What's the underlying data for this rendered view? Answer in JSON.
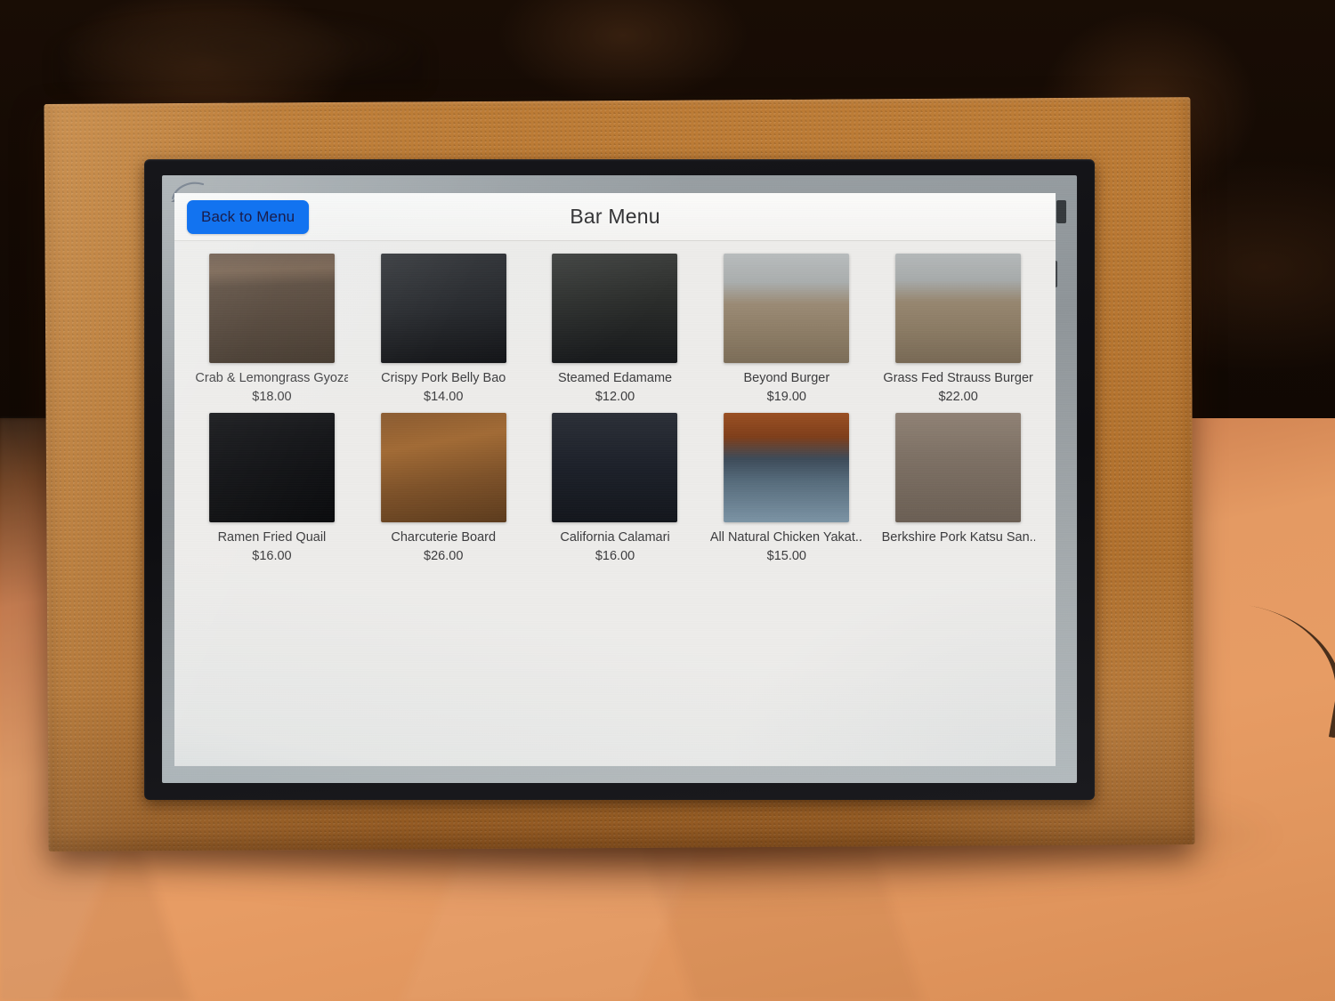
{
  "app": {
    "window_title": "Bar Menu",
    "navbar": {
      "back_label": "Back to Menu",
      "title": "Bar Menu",
      "accent_color": "#1273f0",
      "back_text_color": "#1a1c4a",
      "title_color": "#2c2c2e"
    },
    "colors": {
      "app_background": "#edecea",
      "navbar_background": "#f7f6f4",
      "text": "#3a3a3c",
      "panel_grey": "#9ba2a6",
      "bezel_black": "#141417",
      "stand_fabric": "#b5742f",
      "table_surface": "#e49a63"
    },
    "menu": {
      "columns": 5,
      "items": [
        {
          "name": "Crab & Lemongrass Gyoza",
          "price": "$18.00",
          "photo": "gyoza-on-white-oval-plate-dark-wood",
          "photo_css": "linear-gradient(178deg, #5c4636 0%, #6a513c 16%, #4a3829 30%, #3a2d21 100%), radial-gradient(ellipse 62% 36% at 50% 56%, #cfd6d6 0%, #b9c2c3 46%, #8d9899 70%, rgba(0,0,0,0) 72%), radial-gradient(ellipse 13% 14% at 33% 62%, #c5a168 0%, rgba(0,0,0,0) 70%), radial-gradient(ellipse 13% 14% at 52% 58%, #b8924f 0%, rgba(0,0,0,0) 70%), radial-gradient(ellipse 13% 14% at 70% 52%, #caa264 0%, rgba(0,0,0,0) 70%), radial-gradient(ellipse 11% 10% at 50% 44%, #7fc24a 0%, rgba(0,0,0,0) 72%)"
        },
        {
          "name": "Crispy Pork Belly Bao",
          "price": "$14.00",
          "photo": "pork-belly-bao-buns-on-black-slate",
          "photo_css": "linear-gradient(180deg, #24262a 0%, #1a1c20 52%, #0d0e11 100%), radial-gradient(ellipse 26% 26% at 34% 54%, #f3f2ee 0%, #dcdad4 58%, rgba(0,0,0,0) 74%), radial-gradient(ellipse 26% 26% at 68% 46%, #f3f2ee 0%, #dad8d2 58%, rgba(0,0,0,0) 74%), radial-gradient(ellipse 11% 10% at 42% 60%, #a6572a 0%, rgba(0,0,0,0) 74%), radial-gradient(ellipse 11% 10% at 76% 54%, #9e5227 0%, rgba(0,0,0,0) 74%), radial-gradient(ellipse 7% 6% at 28% 62%, #e0883c 0%, rgba(0,0,0,0) 76%)"
        },
        {
          "name": "Steamed Edamame",
          "price": "$12.00",
          "photo": "edamame-in-dark-bowl-with-lid",
          "photo_css": "linear-gradient(180deg, #3a3c3a 0%, #2a2c2a 40%, #16181a 100%), radial-gradient(ellipse 44% 40% at 50% 58%, #1d3a1e 0%, #14240f 70%, rgba(0,0,0,0) 76%), radial-gradient(ellipse 10% 7% at 40% 56%, #7fae3a 0%, rgba(0,0,0,0) 74%), radial-gradient(ellipse 10% 7% at 58% 62%, #8cb941 0%, rgba(0,0,0,0) 74%), radial-gradient(ellipse 10% 7% at 50% 48%, #79a735 0%, rgba(0,0,0,0) 74%), radial-gradient(ellipse 22% 13% at 62% 24%, #d6d8d3 0%, rgba(0,0,0,0) 74%)"
        },
        {
          "name": "Beyond Burger",
          "price": "$19.00",
          "photo": "burger-with-fries-in-blue-bowl-on-wood",
          "photo_css": "linear-gradient(180deg, #b8bcbd 0%, #a9adad 26%, #9a8a74 46%, #8d7d66 70%, #7b6c57 100%), radial-gradient(ellipse 26% 30% at 63% 27%, #e0b15c 0%, #d2a04c 54%, rgba(0,0,0,0) 72%), radial-gradient(ellipse 20% 24% at 62% 42%, #9fc0d8 0%, #8aafc9 60%, rgba(0,0,0,0) 74%), radial-gradient(ellipse 24% 22% at 30% 50%, #e2b266 0%, #d09f50 62%, rgba(0,0,0,0) 76%), radial-gradient(ellipse 22% 9% at 30% 64%, #6f4228 0%, rgba(0,0,0,0) 76%), radial-gradient(ellipse 20% 6% at 30% 72%, #64a348 0%, rgba(0,0,0,0) 76%), radial-gradient(ellipse 9% 9% at 88% 54%, #f0ece4 0%, rgba(0,0,0,0) 72%), radial-gradient(ellipse 6% 6% at 88% 52%, #a9251c 0%, rgba(0,0,0,0) 74%)"
        },
        {
          "name": "Grass Fed Strauss Burger",
          "price": "$22.00",
          "photo": "burger-with-fries-in-blue-bowl-on-wood",
          "photo_css": "linear-gradient(180deg, #b4b8b9 0%, #a6aaaa 24%, #96866f 44%, #8a7a63 70%, #776854 100%), radial-gradient(ellipse 24% 28% at 33% 24%, #dfb05b 0%, #d09e4b 54%, rgba(0,0,0,0) 72%), radial-gradient(ellipse 19% 23% at 32% 40%, #9cbdd6 0%, #87acc6 60%, rgba(0,0,0,0) 74%), radial-gradient(ellipse 25% 23% at 68% 50%, #e3b368 0%, #d1a052 62%, rgba(0,0,0,0) 76%), radial-gradient(ellipse 22% 9% at 68% 64%, #6d4026 0%, rgba(0,0,0,0) 76%), radial-gradient(ellipse 20% 6% at 68% 72%, #63a247 0%, rgba(0,0,0,0) 76%), radial-gradient(ellipse 11% 9% at 18% 62%, #17201c 0%, rgba(0,0,0,0) 74%)"
        },
        {
          "name": "Ramen Fried Quail",
          "price": "$16.00",
          "photo": "fried-quail-with-microgreens-on-black-plate",
          "photo_css": "linear-gradient(180deg, #141518 0%, #0c0d10 55%, #08090b 100%), radial-gradient(ellipse 40% 34% at 50% 62%, #3e3a26 0%, #262317 64%, rgba(0,0,0,0) 76%), radial-gradient(ellipse 15% 11% at 40% 64%, #6b6332 0%, rgba(0,0,0,0) 74%), radial-gradient(ellipse 15% 11% at 62% 60%, #6f6734 0%, rgba(0,0,0,0) 74%), radial-gradient(ellipse 30% 17% at 50% 33%, #9cc26a 0%, rgba(0,0,0,0) 72%), radial-gradient(ellipse 18% 9% at 44% 24%, #cfe0b4 0%, rgba(0,0,0,0) 74%)"
        },
        {
          "name": "Charcuterie Board",
          "price": "$26.00",
          "photo": "charcuterie-board-with-meats-cheese-crackers",
          "photo_css": "linear-gradient(170deg, #8a5a2f 0%, #a16a34 30%, #7d5128 62%, #5b3a1c 100%), radial-gradient(ellipse 12% 11% at 30% 34%, #b03f3a 0%, rgba(0,0,0,0) 72%), radial-gradient(ellipse 12% 11% at 74% 62%, #a83a35 0%, rgba(0,0,0,0) 72%), radial-gradient(ellipse 10% 10% at 44% 58%, #eae3cb 0%, rgba(0,0,0,0) 74%), radial-gradient(ellipse 10% 10% at 58% 44%, #efe8d0 0%, rgba(0,0,0,0) 74%), radial-gradient(ellipse 9% 9% at 68% 28%, #e8dfc0 0%, rgba(0,0,0,0) 74%), radial-gradient(ellipse 8% 8% at 34% 66%, #d9cfa8 0%, rgba(0,0,0,0) 74%), radial-gradient(ellipse 7% 7% at 52% 24%, #9aa85a 0%, rgba(0,0,0,0) 74%)"
        },
        {
          "name": "California Calamari",
          "price": "$16.00",
          "photo": "fried-calamari-with-lemon-in-dark-skillet",
          "photo_css": "linear-gradient(180deg, #2a2e36 0%, #1c2029 48%, #12151b 100%), radial-gradient(ellipse 44% 42% at 48% 54%, #3a3028 0%, #2a231c 70%, rgba(0,0,0,0) 76%), radial-gradient(ellipse 30% 26% at 44% 56%, #d9a24c 0%, #c28f3e 62%, rgba(0,0,0,0) 76%), radial-gradient(ellipse 13% 13% at 74% 66%, #d2d84e 0%, #b9c23c 62%, rgba(0,0,0,0) 74%), radial-gradient(ellipse 12% 9% at 52% 26%, #7fbb4c 0%, rgba(0,0,0,0) 74%), radial-gradient(ellipse 5% 5% at 44% 34%, #9d78c4 0%, rgba(0,0,0,0) 74%)"
        },
        {
          "name": "All Natural Chicken Yakat...",
          "price": "$15.00",
          "photo": "chicken-yakitori-skewers-on-blue-plate",
          "photo_css": "linear-gradient(180deg, #9a4f22 0%, #7e3d19 22%, #3c4a58 42%, #556a7a 62%, #7b93a4 100%), radial-gradient(ellipse 58% 26% at 50% 58%, #b8ccd8 0%, #9ab3c3 62%, rgba(0,0,0,0) 74%), radial-gradient(ellipse 9% 9% at 34% 52%, #7a4a22 0%, rgba(0,0,0,0) 72%), radial-gradient(ellipse 9% 9% at 50% 50%, #85521f 0%, rgba(0,0,0,0) 72%), radial-gradient(ellipse 9% 9% at 66% 54%, #7c4d22 0%, rgba(0,0,0,0) 72%), radial-gradient(ellipse 12% 10% at 78% 44%, #4f8a3a 0%, rgba(0,0,0,0) 72%), linear-gradient(92deg, rgba(0,0,0,0) 18%, rgba(190,170,140,0.5) 20%, rgba(0,0,0,0) 22%)"
        },
        {
          "name": "Berkshire Pork Katsu San...",
          "price": "",
          "photo": "katsu-sandwich-with-fries-and-ketchup",
          "photo_css": "linear-gradient(180deg, #8f8174 0%, #7d7064 40%, #6a5e53 100%), radial-gradient(ellipse 28% 30% at 70% 22%, #e0b15c 0%, #d09e4c 56%, rgba(0,0,0,0) 72%), radial-gradient(ellipse 22% 26% at 70% 40%, #9dbed6 0%, #88adc7 60%, rgba(0,0,0,0) 74%), radial-gradient(ellipse 16% 22% at 34% 48%, #f2ece0 0%, #e2dacb 60%, rgba(0,0,0,0) 74%), radial-gradient(ellipse 16% 22% at 50% 52%, #f0eade 0%, #ded6c6 60%, rgba(0,0,0,0) 74%), radial-gradient(ellipse 10% 10% at 86% 70%, #eeeae2 0%, rgba(0,0,0,0) 72%), radial-gradient(ellipse 7% 7% at 86% 70%, #9e2218 0%, rgba(0,0,0,0) 74%)"
        }
      ]
    }
  }
}
